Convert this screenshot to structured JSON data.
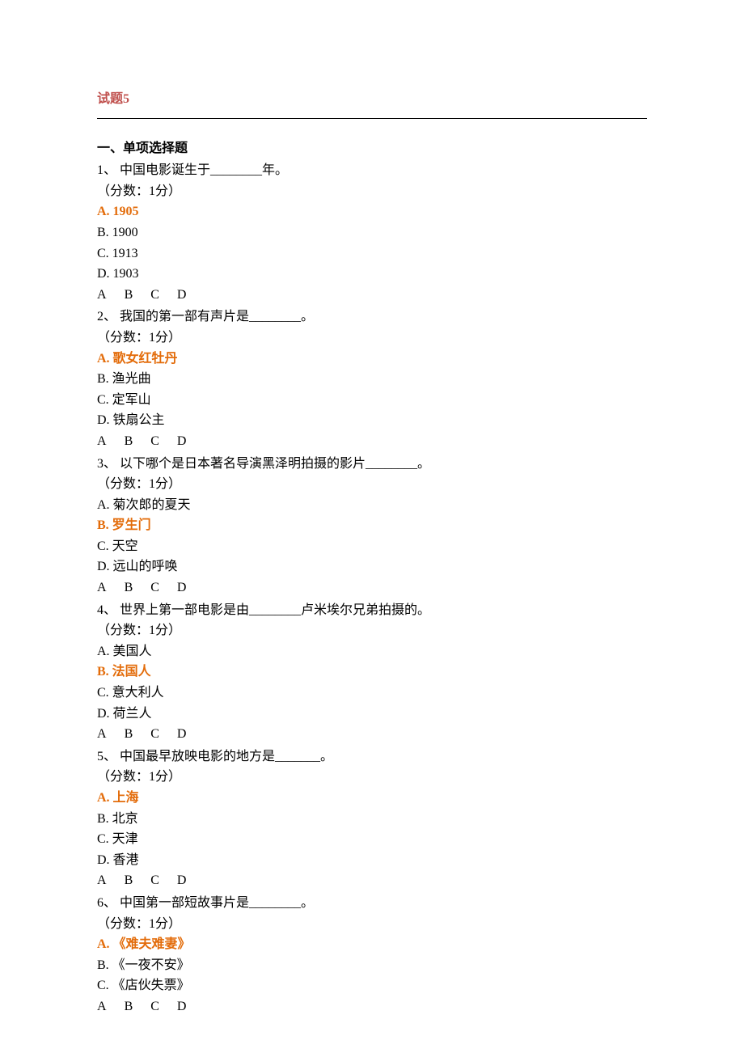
{
  "title": "试题5",
  "section_heading": "一、单项选择题",
  "abcd_row": {
    "a": "A",
    "b": "B",
    "c": "C",
    "d": "D"
  },
  "questions": [
    {
      "num": "1、",
      "text": " 中国电影诞生于________年。",
      "score": "（分数：1分）",
      "opts": [
        {
          "label": "A. 1905",
          "hl": true
        },
        {
          "label": "B. 1900",
          "hl": false
        },
        {
          "label": "C. 1913",
          "hl": false
        },
        {
          "label": "D. 1903",
          "hl": false
        }
      ]
    },
    {
      "num": "2、",
      "text": " 我国的第一部有声片是________。",
      "score": "（分数：1分）",
      "opts": [
        {
          "label": "A. 歌女红牡丹",
          "hl": true
        },
        {
          "label": "B. 渔光曲",
          "hl": false
        },
        {
          "label": "C. 定军山",
          "hl": false
        },
        {
          "label": "D. 铁扇公主",
          "hl": false
        }
      ]
    },
    {
      "num": "3、",
      "text": " 以下哪个是日本著名导演黑泽明拍摄的影片________。",
      "score": "（分数：1分）",
      "opts": [
        {
          "label": "A. 菊次郎的夏天",
          "hl": false
        },
        {
          "label": "B. 罗生门",
          "hl": true
        },
        {
          "label": "C. 天空",
          "hl": false
        },
        {
          "label": "D. 远山的呼唤",
          "hl": false
        }
      ]
    },
    {
      "num": "4、",
      "text": " 世界上第一部电影是由________卢米埃尔兄弟拍摄的。",
      "score": "（分数：1分）",
      "opts": [
        {
          "label": "A. 美国人",
          "hl": false
        },
        {
          "label": "B. 法国人",
          "hl": true
        },
        {
          "label": "C. 意大利人",
          "hl": false
        },
        {
          "label": "D. 荷兰人",
          "hl": false
        }
      ]
    },
    {
      "num": "5、",
      "text": " 中国最早放映电影的地方是_______。",
      "score": "（分数：1分）",
      "opts": [
        {
          "label": "A. 上海",
          "hl": true
        },
        {
          "label": "B. 北京",
          "hl": false
        },
        {
          "label": "C. 天津",
          "hl": false
        },
        {
          "label": "D. 香港",
          "hl": false
        }
      ]
    },
    {
      "num": "6、",
      "text": " 中国第一部短故事片是________。",
      "score": "（分数：1分）",
      "opts": [
        {
          "label": "A. 《难夫难妻》",
          "hl": true
        },
        {
          "label": "B. 《一夜不安》",
          "hl": false
        },
        {
          "label": "C. 《店伙失票》",
          "hl": false
        }
      ]
    }
  ]
}
